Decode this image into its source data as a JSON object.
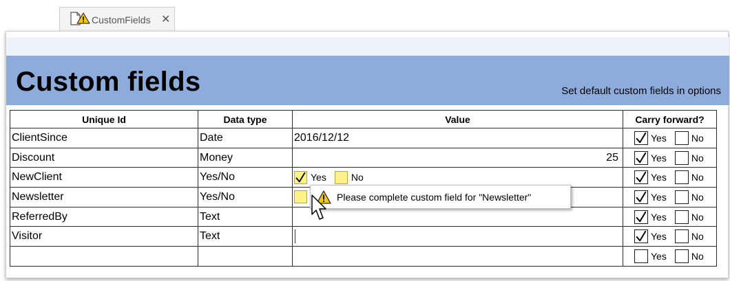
{
  "tab": {
    "label": "CustomFields",
    "close": "✕"
  },
  "page": {
    "title": "Custom fields",
    "options_link": "Set default custom fields in options"
  },
  "table": {
    "headers": [
      "Unique Id",
      "Data type",
      "Value",
      "Carry forward?"
    ],
    "yes_label": "Yes",
    "no_label": "No",
    "rows": [
      {
        "unique_id": "ClientSince",
        "data_type": "Date",
        "value": "2016/12/12",
        "carry_yes": true,
        "carry_no": false
      },
      {
        "unique_id": "Discount",
        "data_type": "Money",
        "value": "25",
        "carry_yes": true,
        "carry_no": false
      },
      {
        "unique_id": "NewClient",
        "data_type": "Yes/No",
        "value": "",
        "value_yes": true,
        "value_no": false,
        "carry_yes": true,
        "carry_no": false
      },
      {
        "unique_id": "Newsletter",
        "data_type": "Yes/No",
        "value": "",
        "carry_yes": true,
        "carry_no": false
      },
      {
        "unique_id": "ReferredBy",
        "data_type": "Text",
        "value": "",
        "carry_yes": true,
        "carry_no": false
      },
      {
        "unique_id": "Visitor",
        "data_type": "Text",
        "value": "",
        "carry_yes": true,
        "carry_no": false
      },
      {
        "unique_id": "",
        "data_type": "",
        "value": "",
        "carry_yes": false,
        "carry_no": false
      }
    ]
  },
  "tooltip": {
    "message": "Please complete custom field for \"Newsletter\""
  },
  "icons": {
    "tab_icon": "document-warning-icon",
    "tooltip_icon": "warning-icon",
    "checkmark": "checkmark-icon"
  },
  "colors": {
    "banner": "#8dacdc",
    "warning": "#f5c518",
    "yesno_box": "#fff28a"
  }
}
